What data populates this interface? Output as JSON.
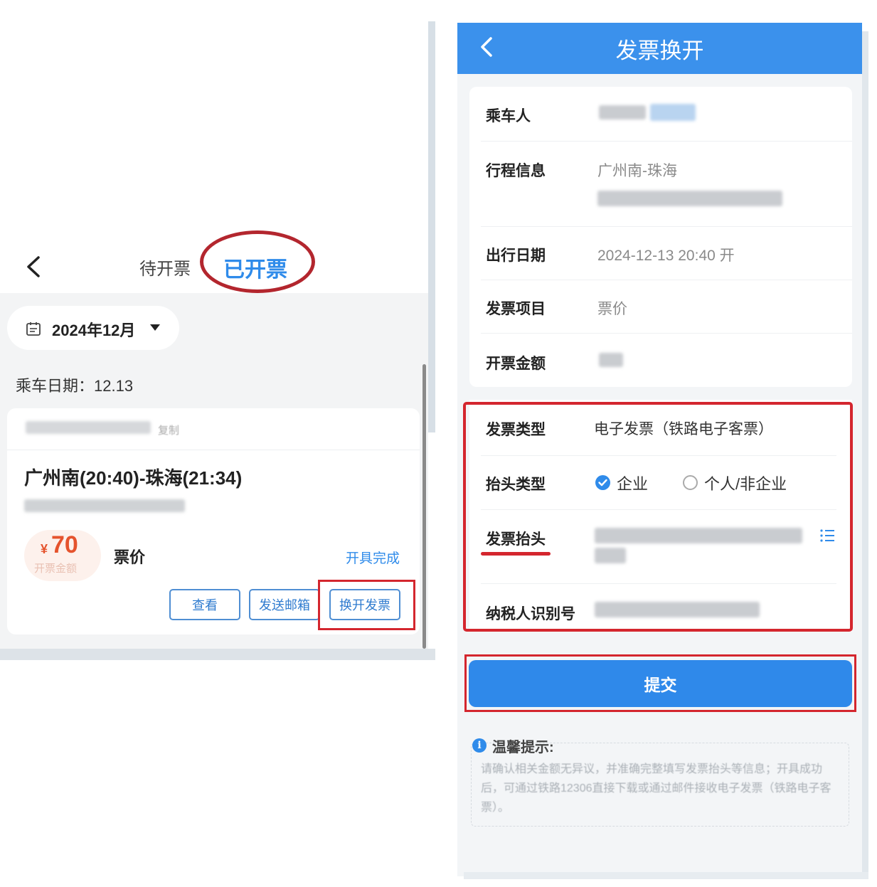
{
  "left_screen": {
    "tabs": {
      "pending_label": "待开票",
      "issued_label": "已开票"
    },
    "month_filter": {
      "label": "2024年12月"
    },
    "ride_date": "乘车日期：12.13",
    "order_card": {
      "copy_label": "复制",
      "route": "广州南(20:40)-珠海(21:34)",
      "price_symbol": "¥",
      "price": "70",
      "price_caption": "开票金额",
      "ticket_type": "票价",
      "status": "开具完成",
      "buttons": {
        "view": "查看",
        "send_email": "发送邮箱",
        "reissue": "换开发票"
      }
    }
  },
  "right_screen": {
    "header_title": "发票换开",
    "rows": {
      "passenger_label": "乘车人",
      "trip_label": "行程信息",
      "trip_value": "广州南-珠海",
      "date_label": "出行日期",
      "date_value": "2024-12-13 20:40 开",
      "item_label": "发票项目",
      "item_value": "票价",
      "amount_label": "开票金额"
    },
    "invoice": {
      "type_label": "发票类型",
      "type_value": "电子发票（铁路电子客票）",
      "header_type_label": "抬头类型",
      "option_enterprise": "企业",
      "option_personal": "个人/非企业",
      "title_label": "发票抬头",
      "taxpayer_label": "纳税人识别号"
    },
    "submit_label": "提交",
    "tips": {
      "title": "温馨提示:",
      "text": "请确认相关金额无异议，并准确完整填写发票抬头等信息；开具成功后，可通过铁路12306直接下载或通过邮件接收电子发票（铁路电子客票）。"
    }
  },
  "colors": {
    "accent_blue": "#2f8bea",
    "header_blue": "#3b91ec",
    "annotation_red": "#d4262e",
    "price_orange": "#e5532d"
  }
}
